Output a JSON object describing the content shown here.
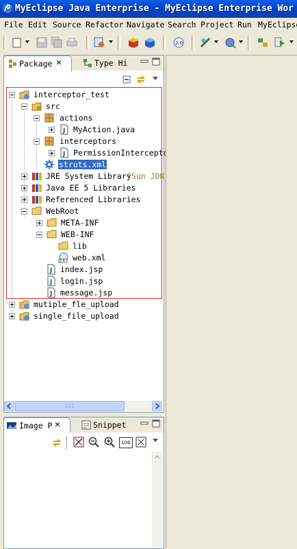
{
  "window": {
    "title": "MyEclipse Java Enterprise - MyEclipse Enterprise Wor"
  },
  "menu": [
    "File",
    "Edit",
    "Source",
    "Refactor",
    "Navigate",
    "Search",
    "Project",
    "Run",
    "MyEclipse"
  ],
  "package_view": {
    "tabs": [
      {
        "label": "Package",
        "icon": "package-explorer-icon",
        "active": true
      },
      {
        "label": "Type Hi",
        "icon": "type-hierarchy-icon",
        "active": false
      }
    ],
    "tree": [
      {
        "label": "interceptor_test",
        "icon": "web-project-icon",
        "twisty": "open"
      },
      {
        "label": "src",
        "icon": "source-folder-icon",
        "twisty": "open"
      },
      {
        "label": "actions",
        "icon": "package-icon",
        "twisty": "open"
      },
      {
        "label": "MyAction.java",
        "icon": "java-file-icon",
        "twisty": "closed"
      },
      {
        "label": "interceptors",
        "icon": "package-icon",
        "twisty": "open"
      },
      {
        "label": "PermissionInterceptor.",
        "icon": "java-file-icon",
        "twisty": "closed"
      },
      {
        "label": "struts.xml",
        "icon": "struts-config-icon",
        "twisty": "none",
        "selected": true
      },
      {
        "label": "JRE System Library",
        "decoration": "[Sun JDK",
        "icon": "library-icon",
        "twisty": "closed"
      },
      {
        "label": "Java EE 5 Libraries",
        "icon": "library-icon",
        "twisty": "closed"
      },
      {
        "label": "Referenced Libraries",
        "icon": "library-icon",
        "twisty": "closed"
      },
      {
        "label": "WebRoot",
        "icon": "folder-icon",
        "twisty": "open"
      },
      {
        "label": "META-INF",
        "icon": "folder-icon",
        "twisty": "closed"
      },
      {
        "label": "WEB-INF",
        "icon": "folder-icon",
        "twisty": "open"
      },
      {
        "label": "lib",
        "icon": "folder-icon",
        "twisty": "none"
      },
      {
        "label": "web.xml",
        "icon": "web-xml-icon",
        "twisty": "none"
      },
      {
        "label": "index.jsp",
        "icon": "jsp-file-icon",
        "twisty": "none"
      },
      {
        "label": "login.jsp",
        "icon": "jsp-file-icon",
        "twisty": "none"
      },
      {
        "label": "message.jsp",
        "icon": "jsp-file-icon",
        "twisty": "none"
      },
      {
        "label": "mutiple_fle_upload",
        "icon": "web-project-icon",
        "twisty": "closed"
      },
      {
        "label": "single_file_upload",
        "icon": "web-project-icon",
        "twisty": "closed"
      }
    ],
    "scroll_thumb_label": "III"
  },
  "image_view": {
    "tabs": [
      {
        "label": "Image P",
        "icon": "image-preview-icon",
        "active": true
      },
      {
        "label": "Snippet",
        "icon": "snippet-icon",
        "active": false
      }
    ],
    "zoom_badge": "100"
  },
  "colors": {
    "selection": "#316ac5",
    "highlight_box": "#e0282d",
    "title_bar": "#0a5fe6"
  }
}
